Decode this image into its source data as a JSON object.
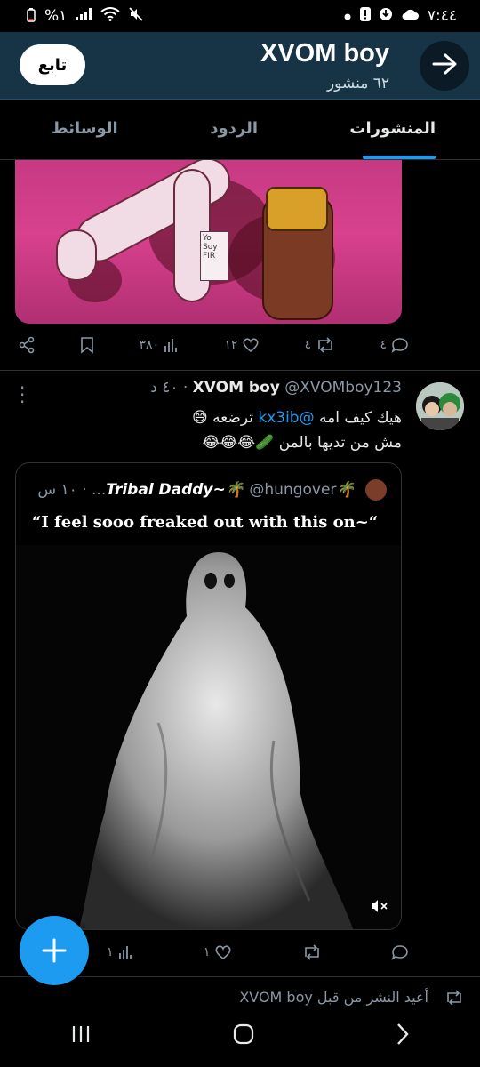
{
  "status_bar": {
    "time": "٧:٤٤",
    "battery": "%١",
    "icons": [
      "battery-icon",
      "signal-icon",
      "wifi-icon",
      "mute-icon",
      "dot-icon",
      "notification-icon",
      "download-icon",
      "cloud-icon"
    ]
  },
  "header": {
    "name": "XVOM boy",
    "post_count": "٦٢ منشور",
    "follow_label": "تابع",
    "background": "#163446"
  },
  "tabs": [
    {
      "label": "المنشورات",
      "active": true
    },
    {
      "label": "الردود",
      "active": false
    },
    {
      "label": "الوسائط",
      "active": false
    }
  ],
  "prev_tweet_actions": {
    "replies": "٤",
    "retweets": "٤",
    "likes": "١٢",
    "views": "٣٨٠"
  },
  "tweet": {
    "name": "XVOM boy",
    "handle": "@XVOMboy123",
    "time": "٤٠ د",
    "line1_pre": "هيك كيف امه",
    "mention": "@kx3ib",
    "line1_post": "ترضعه 😅",
    "line2": "مش من تديها بالمن 🥒😂😂😂"
  },
  "quote": {
    "name": "🌴Tribal Daddy~🌴",
    "handle": "@hungover...",
    "time": "١٠ س",
    "text": "“I feel sooo freaked out with this on~“"
  },
  "quote_actions": {
    "replies": "",
    "retweets": "",
    "likes": "١",
    "views": "١"
  },
  "retweet_note": "أعيد النشر من قبل XVOM boy",
  "colors": {
    "accent": "#1d9bf0",
    "muted_text": "#8b98a5",
    "divider": "#2f3336"
  }
}
